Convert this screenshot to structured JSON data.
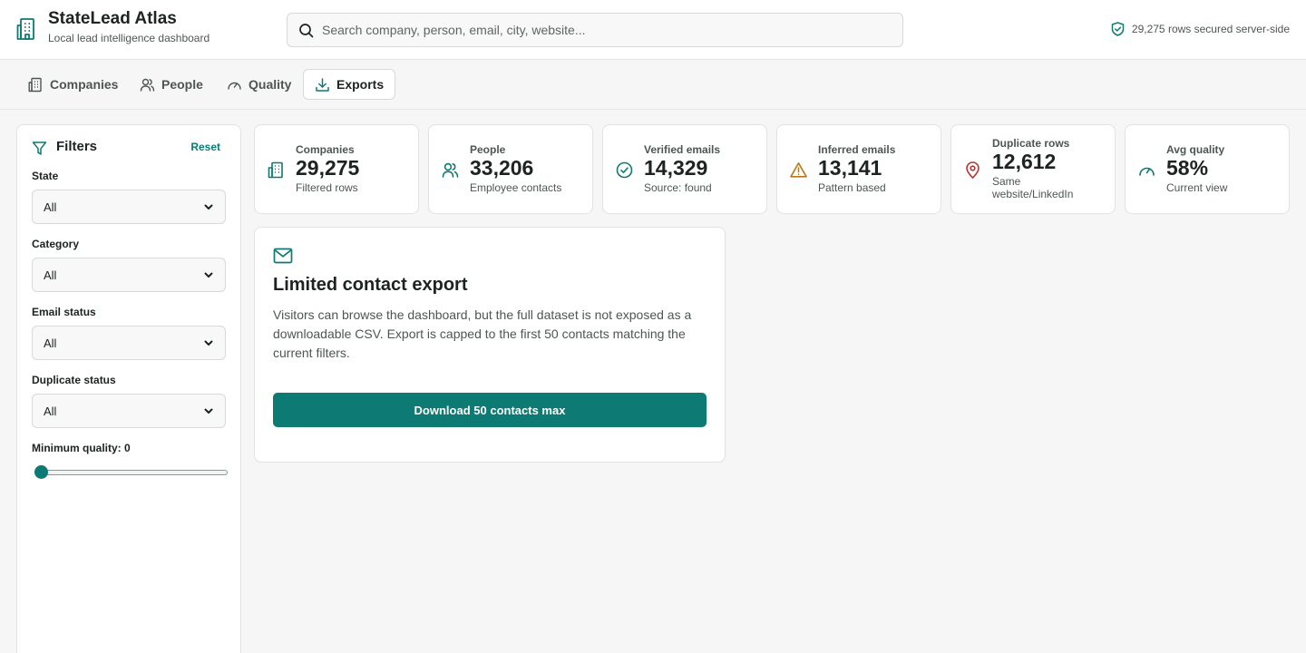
{
  "header": {
    "title": "StateLead Atlas",
    "subtitle": "Local lead intelligence dashboard",
    "search_placeholder": "Search company, person, email, city, website...",
    "secure_text": "29,275 rows secured server-side"
  },
  "tabs": [
    {
      "label": "Companies",
      "icon": "building-icon",
      "active": false
    },
    {
      "label": "People",
      "icon": "users-icon",
      "active": false
    },
    {
      "label": "Quality",
      "icon": "gauge-icon",
      "active": false
    },
    {
      "label": "Exports",
      "icon": "download-icon",
      "active": true
    }
  ],
  "filters": {
    "title": "Filters",
    "reset_label": "Reset",
    "state": {
      "label": "State",
      "value": "All"
    },
    "category": {
      "label": "Category",
      "value": "All"
    },
    "email_status": {
      "label": "Email status",
      "value": "All"
    },
    "duplicate_status": {
      "label": "Duplicate status",
      "value": "All"
    },
    "min_quality": {
      "label": "Minimum quality: 0",
      "value": 0,
      "min": 0,
      "max": 100
    }
  },
  "stats": [
    {
      "label": "Companies",
      "value": "29,275",
      "sub": "Filtered rows",
      "icon": "building-icon",
      "color": "#0e7a74"
    },
    {
      "label": "People",
      "value": "33,206",
      "sub": "Employee contacts",
      "icon": "users-icon",
      "color": "#0e7a74"
    },
    {
      "label": "Verified emails",
      "value": "14,329",
      "sub": "Source: found",
      "icon": "check-circle-icon",
      "color": "#0e7a74"
    },
    {
      "label": "Inferred emails",
      "value": "13,141",
      "sub": "Pattern based",
      "icon": "warning-icon",
      "color": "#b7791f"
    },
    {
      "label": "Duplicate rows",
      "value": "12,612",
      "sub": "Same website/LinkedIn",
      "icon": "map-pin-icon",
      "color": "#b83232"
    },
    {
      "label": "Avg quality",
      "value": "58%",
      "sub": "Current view",
      "icon": "gauge-icon",
      "color": "#0e7a74"
    }
  ],
  "export": {
    "title": "Limited contact export",
    "description": "Visitors can browse the dashboard, but the full dataset is not exposed as a downloadable CSV. Export is capped to the first 50 contacts matching the current filters.",
    "button_label": "Download 50 contacts max"
  },
  "colors": {
    "accent": "#0e7a74",
    "warning": "#b7791f",
    "danger": "#b83232"
  }
}
